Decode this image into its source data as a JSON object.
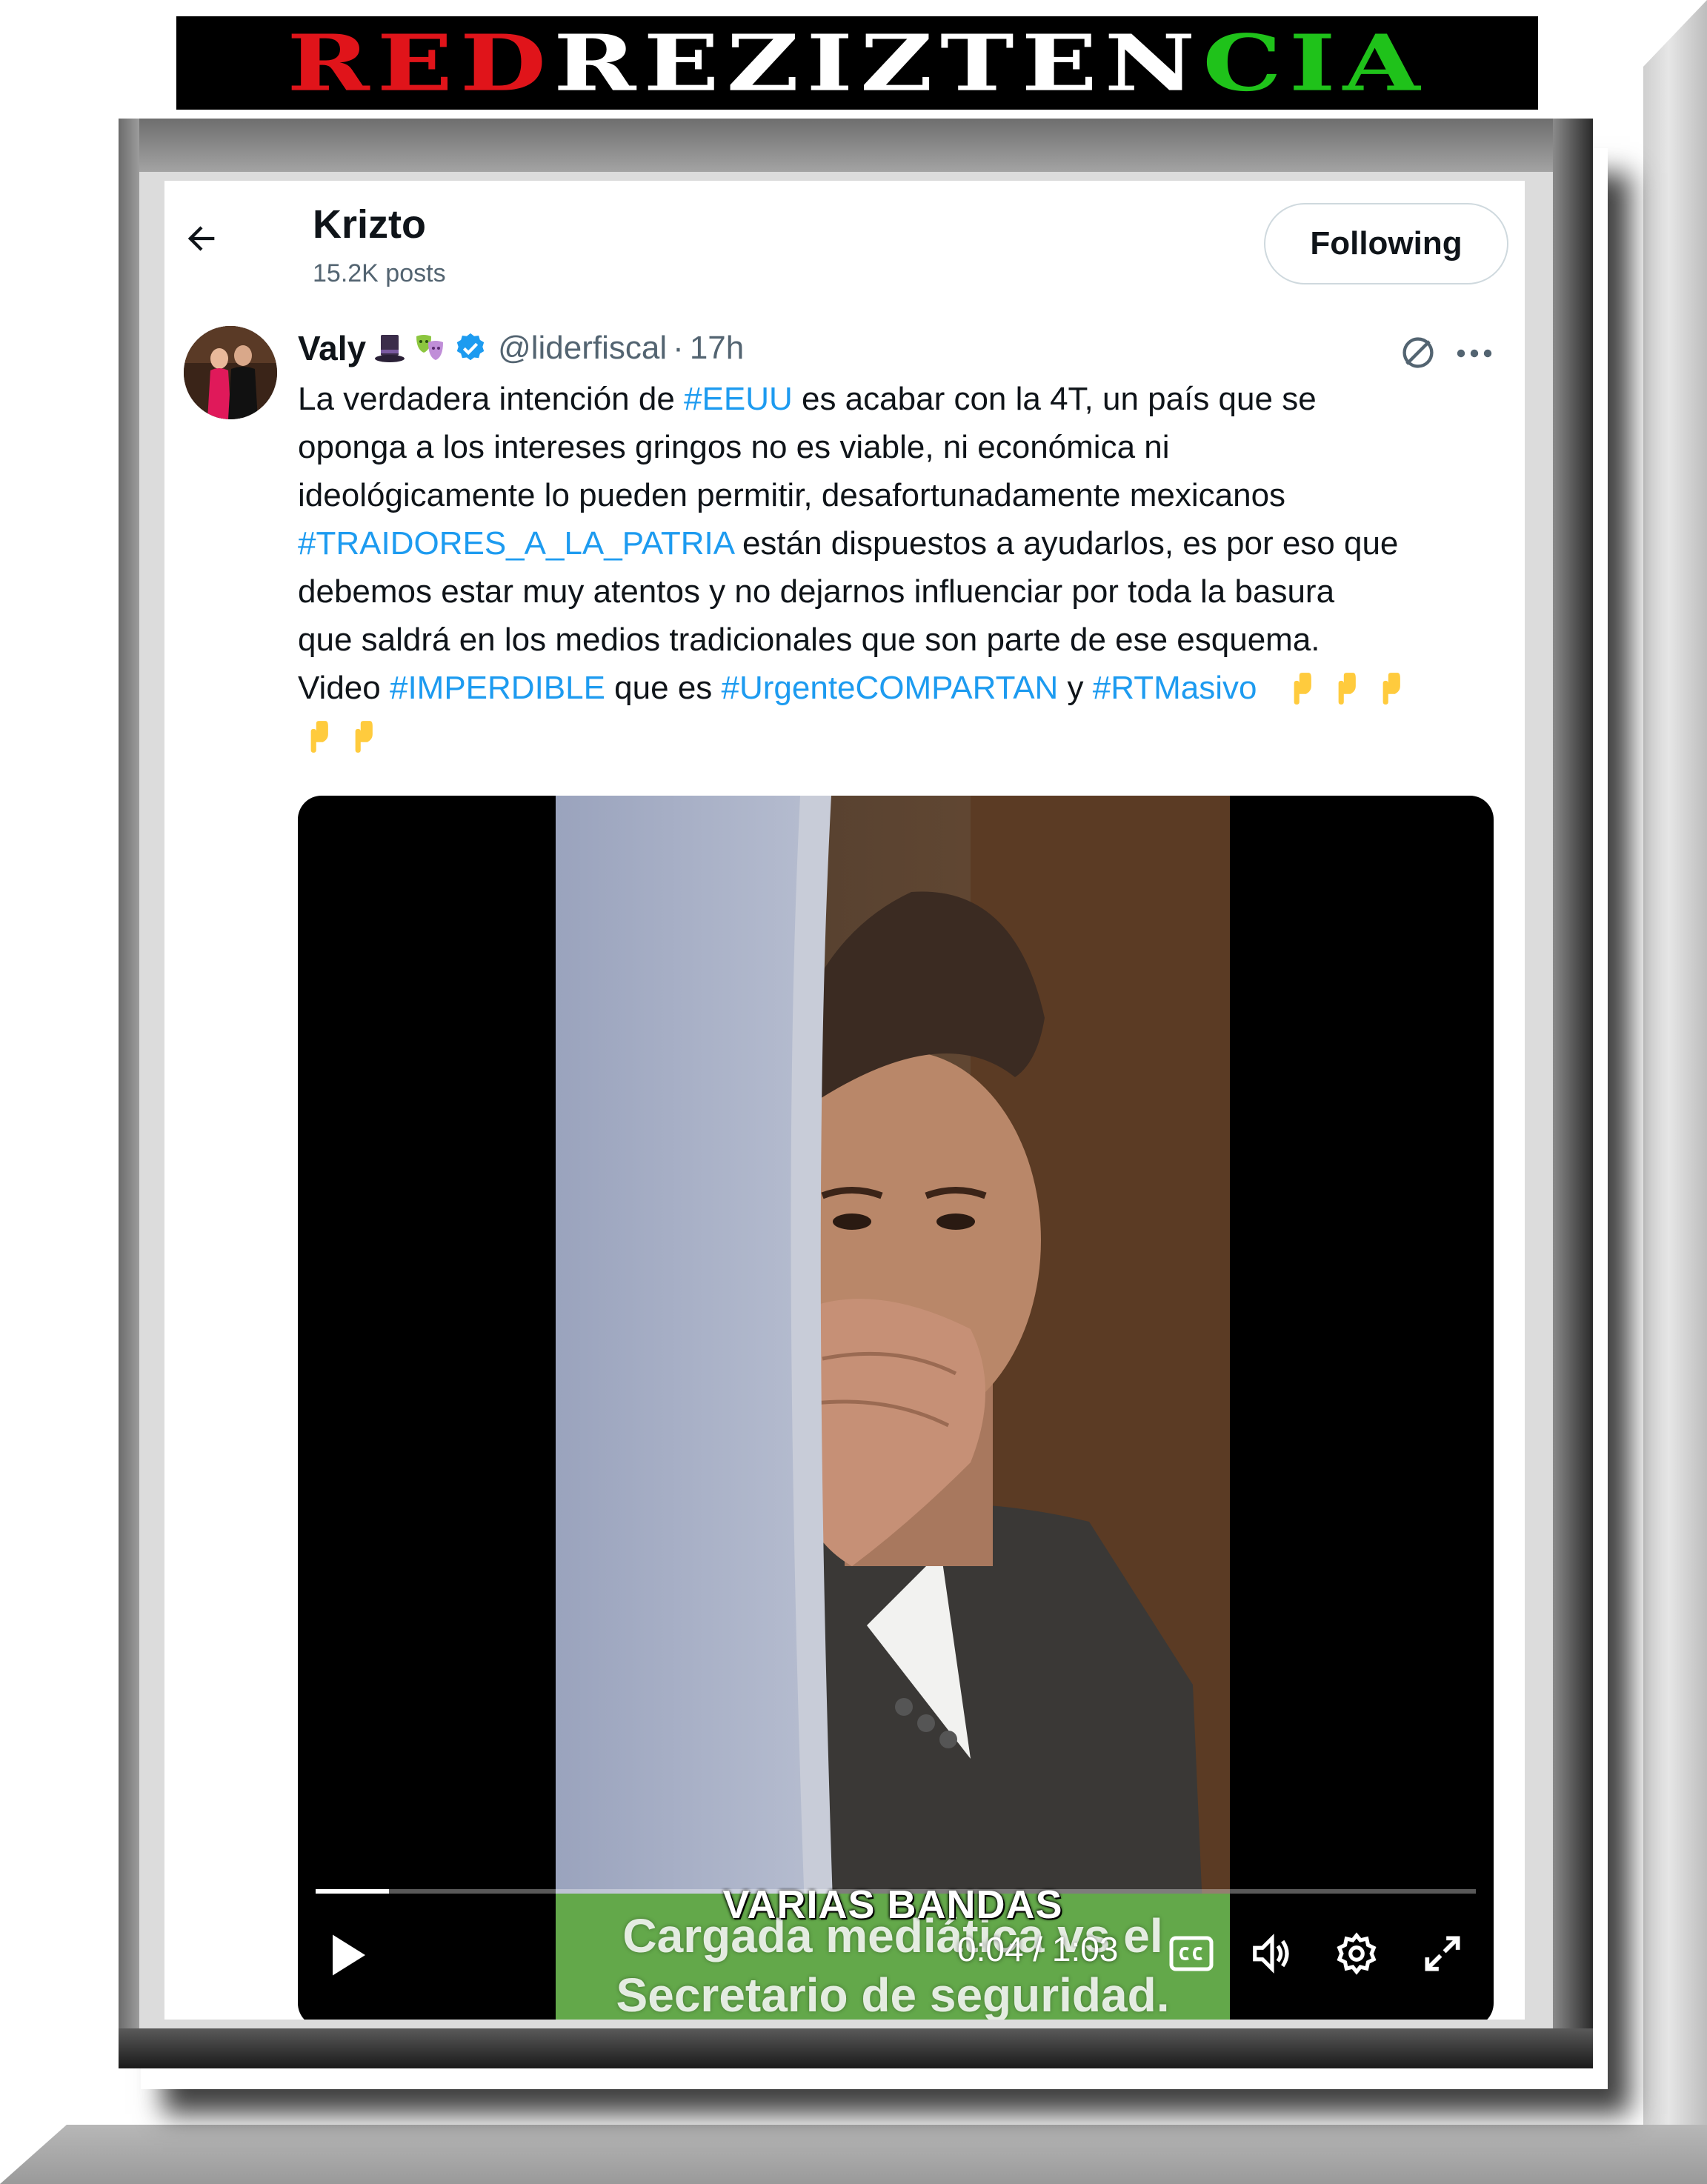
{
  "banner": {
    "part_red": "RED",
    "part_white": "REZIZTEN",
    "part_green": "CIA",
    "colors": {
      "red": "#e0141a",
      "white": "#ffffff",
      "green": "#1fc21a"
    }
  },
  "header": {
    "account_name": "Krizto",
    "posts_count": "15.2K posts",
    "follow_label": "Following",
    "back_icon": "arrow-left-icon"
  },
  "tweet": {
    "display_name": "Valy",
    "emojis": [
      "top-hat-emoji",
      "theater-masks-emoji"
    ],
    "verified_icon": "verified-badge-icon",
    "handle": "@liderfiscal",
    "separator": "·",
    "time": "17h",
    "text": {
      "l1_a": "La verdadera intención de ",
      "l1_tag": "#EEUU",
      "l1_b": " es acabar con la 4T, un país que se",
      "l2": "oponga a los intereses gringos no es viable, ni económica ni",
      "l3": "ideológicamente lo pueden permitir, desafortunadamente mexicanos",
      "l4_tag": "#TRAIDORES_A_LA_PATRIA",
      "l4_b": " están dispuestos a ayudarlos, es por eso que",
      "l5": "debemos estar muy atentos y no dejarnos influenciar por toda la basura",
      "l6": "que saldrá en los medios tradicionales que son parte de ese esquema.",
      "l7_a": "Video ",
      "l7_tag1": "#IMPERDIBLE",
      "l7_b": " que es ",
      "l7_tag2": "#UrgenteCOMPARTAN",
      "l7_c": " y ",
      "l7_tag3": "#RTMasivo"
    },
    "emoji_pointing_down_count": 5,
    "hashtag_color": "#1d9bf0"
  },
  "video": {
    "caption_overlay": "VARIAS BANDAS",
    "caption_line1": "Cargada mediática vs el",
    "caption_line2": "Secretario de seguridad.",
    "current_time": "0:04",
    "time_separator": " / ",
    "duration": "1:03",
    "progress_fraction": 0.063,
    "caption_bg_color": "#63a84a",
    "controls": [
      "play-icon",
      "closed-captions-icon",
      "volume-icon",
      "settings-gear-icon",
      "fullscreen-expand-icon"
    ]
  }
}
